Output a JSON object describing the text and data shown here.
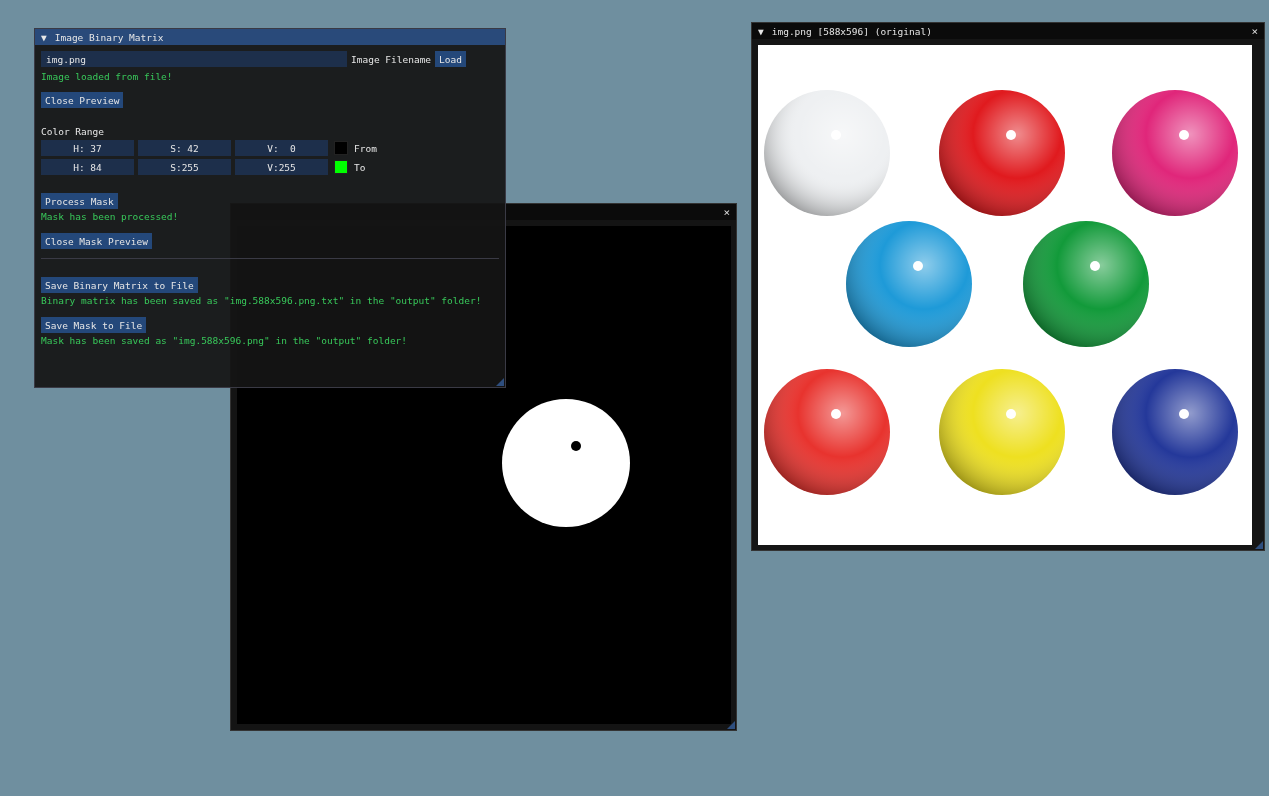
{
  "control_panel": {
    "title": "Image Binary Matrix",
    "collapse_arrow": "▼",
    "filename_field": {
      "value": "img.png",
      "label": "Image Filename"
    },
    "load_button": "Load",
    "load_status": "Image loaded from file!",
    "close_preview_button": "Close Preview",
    "color_range_label": "Color Range",
    "color_range": [
      {
        "fields": [
          "H: 37",
          "S: 42",
          "V:  0"
        ],
        "color": "#000000",
        "label": "From"
      },
      {
        "fields": [
          "H: 84",
          "S:255",
          "V:255"
        ],
        "color": "#00ff00",
        "label": "To"
      }
    ],
    "process_mask_button": "Process Mask",
    "process_status": "Mask has been processed!",
    "close_mask_preview_button": "Close Mask Preview",
    "save_matrix_button": "Save Binary Matrix to File",
    "save_matrix_status": "Binary matrix has been saved as \"img.588x596.png.txt\" in the \"output\" folder!",
    "save_mask_button": "Save Mask to File",
    "save_mask_status": "Mask has been saved as \"img.588x596.png\" in the \"output\" folder!"
  },
  "mask_window": {
    "close": "×"
  },
  "original_window": {
    "title": "img.png [588x596] (original)",
    "collapse_arrow": "▼",
    "close": "×",
    "spheres": [
      {
        "color": "#eef0f2"
      },
      {
        "color": "#e01a1e"
      },
      {
        "color": "#e0267a"
      },
      {
        "color": "#1e9ad8"
      },
      {
        "color": "#129a3a"
      },
      {
        "color": "#e8332e"
      },
      {
        "color": "#eee020"
      },
      {
        "color": "#24389a"
      }
    ]
  }
}
